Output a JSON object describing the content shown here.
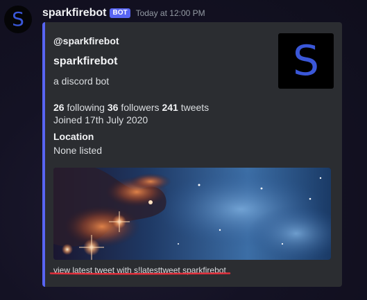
{
  "message": {
    "avatar_letter": "S",
    "username": "sparkfirebot",
    "bot_tag": "BOT",
    "timestamp": "Today at 12:00 PM"
  },
  "embed": {
    "accent_color": "#5865f2",
    "author": "@sparkfirebot",
    "title": "sparkfirebot",
    "description": "a discord bot",
    "stats": {
      "following_count": "26",
      "following_label": "following",
      "followers_count": "36",
      "followers_label": "followers",
      "tweets_count": "241",
      "tweets_label": "tweets"
    },
    "joined": "Joined 17th July 2020",
    "field": {
      "name": "Location",
      "value": "None listed"
    },
    "thumbnail_letter": "S",
    "image_icon": "space-nebula-image",
    "footer": "view latest tweet with s!latesttweet sparkfirebot"
  },
  "annotation": {
    "underline_color": "#e0303c"
  }
}
